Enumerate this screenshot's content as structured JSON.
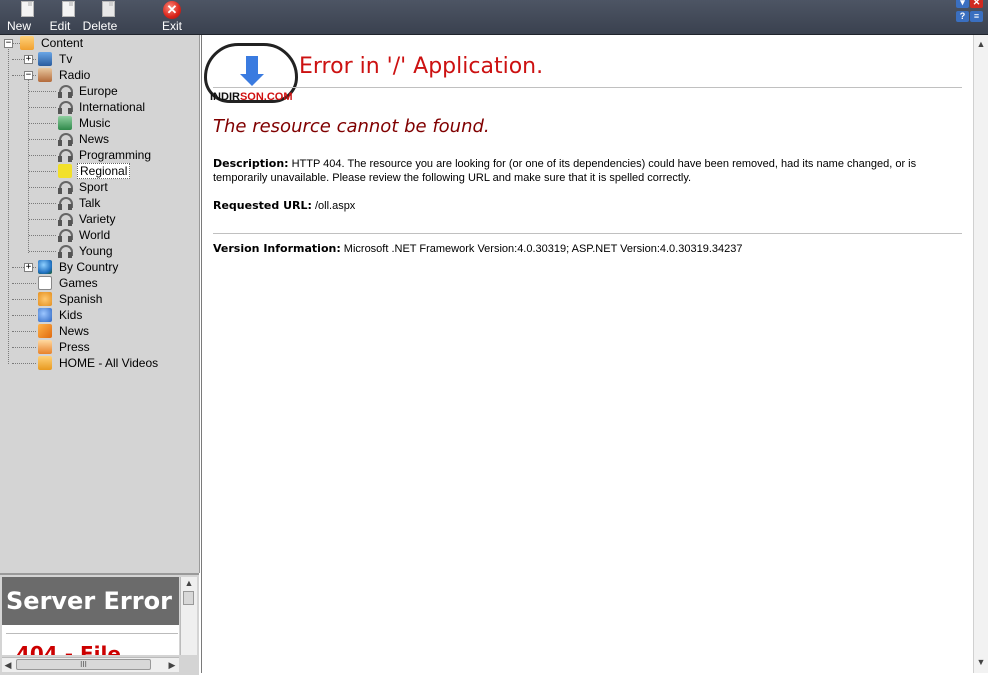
{
  "toolbar": {
    "new_label": "New",
    "edit_label": "Edit",
    "delete_label": "Delete",
    "exit_label": "Exit",
    "exit_glyph": "✕"
  },
  "window_controls": {
    "help_glyph": "?",
    "menu_glyph": "≡",
    "minimize_glyph": "▾",
    "close_glyph": "✕"
  },
  "tree": {
    "root": "Content",
    "items": [
      {
        "label": "Tv",
        "icon": "tv-icon",
        "expander": "+"
      },
      {
        "label": "Radio",
        "icon": "radio-icon",
        "expander": "−"
      },
      {
        "label": "Europe",
        "icon": "headphones-icon"
      },
      {
        "label": "International",
        "icon": "headphones-icon"
      },
      {
        "label": "Music",
        "icon": "music-icon"
      },
      {
        "label": "News",
        "icon": "headphones-icon"
      },
      {
        "label": "Programming",
        "icon": "headphones-icon"
      },
      {
        "label": "Regional",
        "icon": "regional-icon",
        "selected": true
      },
      {
        "label": "Sport",
        "icon": "headphones-icon"
      },
      {
        "label": "Talk",
        "icon": "headphones-icon"
      },
      {
        "label": "Variety",
        "icon": "headphones-icon"
      },
      {
        "label": "World",
        "icon": "headphones-icon"
      },
      {
        "label": "Young",
        "icon": "headphones-icon"
      },
      {
        "label": "By Country",
        "icon": "globe-icon",
        "expander": "+"
      },
      {
        "label": "Games",
        "icon": "games-icon"
      },
      {
        "label": "Spanish",
        "icon": "spanish-icon"
      },
      {
        "label": "Kids",
        "icon": "kids-icon"
      },
      {
        "label": "News",
        "icon": "rss-icon"
      },
      {
        "label": "Press",
        "icon": "press-icon"
      },
      {
        "label": "HOME  - All Videos",
        "icon": "home-icon"
      }
    ]
  },
  "preview": {
    "header": "Server Error",
    "subheader": "404 - File",
    "hscroll_grip": "III"
  },
  "content": {
    "logo_brand_left": "INDIR",
    "logo_brand_right": "SON.COM",
    "title": "Error in '/' Application.",
    "subtitle": "The resource cannot be found.",
    "description_label": "Description:",
    "description_text": "HTTP 404. The resource you are looking for (or one of its dependencies) could have been removed, had its name changed, or is temporarily unavailable.  Please review the following URL and make sure that it is spelled correctly.",
    "requested_url_label": "Requested URL:",
    "requested_url": "/oll.aspx",
    "version_label": "Version Information:",
    "version_text": "Microsoft .NET Framework Version:4.0.30319; ASP.NET Version:4.0.30319.34237"
  },
  "colors": {
    "toolbar_bg": "#434a58",
    "sidebar_bg": "#d4d4d4",
    "error_title": "#cc1111",
    "error_subtitle": "#800000"
  }
}
